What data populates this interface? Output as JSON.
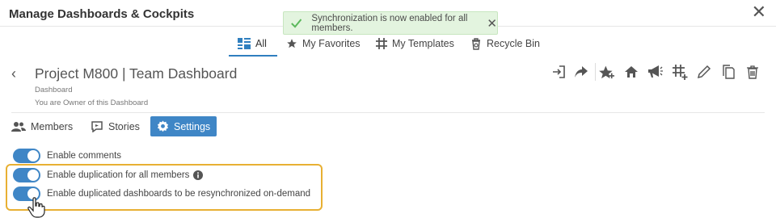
{
  "window": {
    "title": "Manage Dashboards & Cockpits",
    "close_label": "✕"
  },
  "toast": {
    "message": "Synchronization is now enabled for all members.",
    "close_label": "✕",
    "accent": "#5cb85c"
  },
  "tabs": [
    {
      "label": "All",
      "icon": "grid-icon",
      "active": true
    },
    {
      "label": "My Favorites",
      "icon": "star-icon"
    },
    {
      "label": "My Templates",
      "icon": "hashtag-grid-icon"
    },
    {
      "label": "Recycle Bin",
      "icon": "recycle-bin-icon"
    }
  ],
  "dashboard": {
    "back_label": "‹",
    "title": "Project M800 | Team Dashboard",
    "type": "Dashboard",
    "owner_text": "You are Owner of this Dashboard"
  },
  "toolbar": [
    "enter-icon",
    "share-icon",
    "star-add-icon",
    "home-icon",
    "megaphone-icon",
    "grid-add-icon",
    "edit-pencil-icon",
    "copy-icon",
    "trash-icon"
  ],
  "sub_tabs": [
    {
      "label": "Members",
      "icon": "members-icon"
    },
    {
      "label": "Stories",
      "icon": "stories-icon"
    },
    {
      "label": "Settings",
      "icon": "gear-icon",
      "active": true
    }
  ],
  "settings": [
    {
      "label": "Enable comments",
      "enabled": true
    },
    {
      "label": "Enable duplication for all members",
      "enabled": true,
      "info": true
    },
    {
      "label": "Enable duplicated dashboards to be resynchronized on-demand",
      "enabled": true
    }
  ],
  "colors": {
    "accent": "#3f86c6",
    "highlight": "#e8b033",
    "toast_bg": "#e3f4df"
  }
}
